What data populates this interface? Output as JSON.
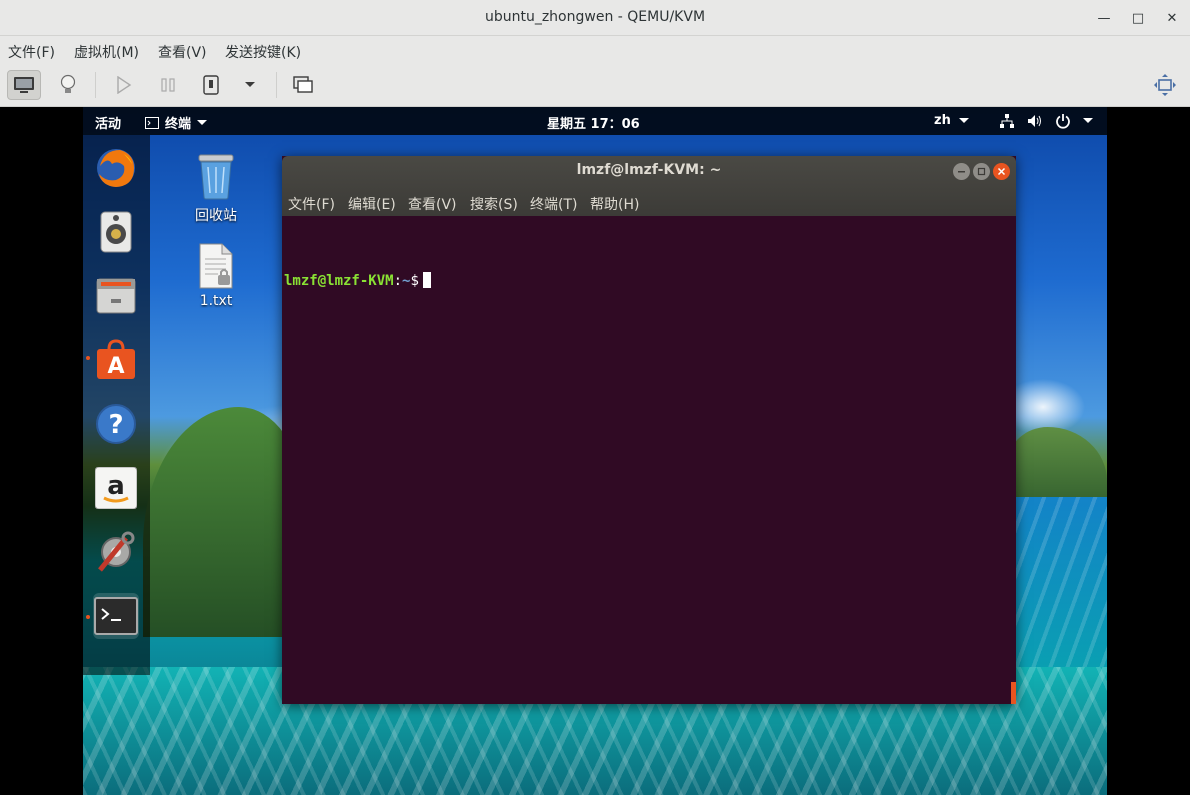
{
  "host": {
    "title": "ubuntu_zhongwen - QEMU/KVM",
    "controls": {
      "minimize": "—",
      "maximize": "□",
      "close": "✕"
    },
    "menu": [
      "文件(F)",
      "虚拟机(M)",
      "查看(V)",
      "发送按键(K)"
    ],
    "toolbar_icons": [
      "monitor-icon",
      "lightbulb-icon",
      "play-icon",
      "pause-icon",
      "power-icon",
      "dropdown-icon",
      "screenshot-icon",
      "fullscreen-icon"
    ]
  },
  "guest": {
    "panel": {
      "activities": "活动",
      "app_menu": "终端",
      "clock": "星期五 17：06",
      "input_method": "zh"
    },
    "dock": [
      "firefox-icon",
      "rhythmbox-icon",
      "files-icon",
      "software-icon",
      "help-icon",
      "amazon-icon",
      "settings-icon",
      "terminal-icon"
    ],
    "desktop_icons": [
      {
        "label": "回收站",
        "icon": "trash-icon"
      },
      {
        "label": "1.txt",
        "icon": "text-file-icon"
      }
    ],
    "terminal": {
      "title": "lmzf@lmzf-KVM: ~",
      "menu": [
        "文件(F)",
        "编辑(E)",
        "查看(V)",
        "搜索(S)",
        "终端(T)",
        "帮助(H)"
      ],
      "prompt_user": "lmzf@lmzf-KVM",
      "prompt_sep": ":",
      "prompt_path": "~",
      "prompt_symbol": "$"
    }
  },
  "colors": {
    "terminal_bg": "#300a24",
    "ubuntu_orange": "#e95420",
    "prompt_green": "#8ae234",
    "prompt_blue": "#729fcf"
  }
}
